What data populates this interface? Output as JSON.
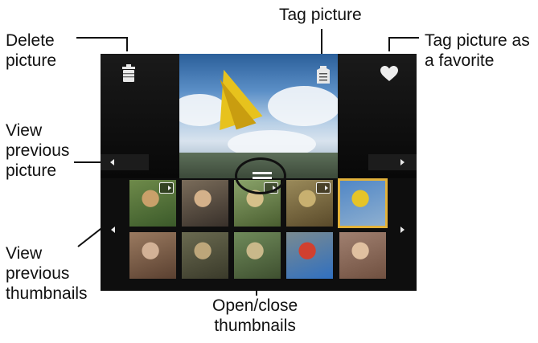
{
  "callouts": {
    "delete": "Delete\npicture",
    "tag": "Tag picture",
    "favorite": "Tag picture as\na favorite",
    "view_previous_picture": "View\nprevious\npicture",
    "view_previous_thumbnails": "View\nprevious\nthumbnails",
    "open_close_thumbnails": "Open/close\nthumbnails"
  },
  "colors": {
    "screen_bg": "#0b0b0b",
    "selection": "#e2b23b",
    "kite": "#e7c21d",
    "sky": "#5b8fc7"
  },
  "icons": {
    "delete": "trash-icon",
    "tag": "tag-icon",
    "favorite": "heart-icon",
    "prev_picture": "left-arrow-icon",
    "next_picture": "right-arrow-icon",
    "prev_thumbs": "left-arrow-icon",
    "next_thumbs": "right-arrow-icon",
    "video_badge": "video-camera-icon",
    "thumbs_handle": "handle-icon"
  },
  "thumbnails": [
    {
      "row": 1,
      "has_video_badge": true,
      "selected": false,
      "colors": [
        "#6e8a4a",
        "#c9a06a",
        "#3b5a2a"
      ]
    },
    {
      "row": 1,
      "has_video_badge": false,
      "selected": false,
      "colors": [
        "#7a6c5a",
        "#d4b18a",
        "#38302a"
      ]
    },
    {
      "row": 1,
      "has_video_badge": true,
      "selected": false,
      "colors": [
        "#8aa36a",
        "#d6c08a",
        "#4a5e30"
      ]
    },
    {
      "row": 1,
      "has_video_badge": true,
      "selected": false,
      "colors": [
        "#9a8a5a",
        "#c8b070",
        "#5a4a2a"
      ]
    },
    {
      "row": 1,
      "has_video_badge": false,
      "selected": true,
      "colors": [
        "#4f86c6",
        "#e6c429",
        "#8fb0d0"
      ]
    },
    {
      "row": 2,
      "has_video_badge": false,
      "selected": false,
      "colors": [
        "#9a7a60",
        "#d2b196",
        "#5a4030"
      ]
    },
    {
      "row": 2,
      "has_video_badge": false,
      "selected": false,
      "colors": [
        "#6a6a50",
        "#bda67a",
        "#3a3a2a"
      ]
    },
    {
      "row": 2,
      "has_video_badge": false,
      "selected": false,
      "colors": [
        "#6f8a5a",
        "#c9b88a",
        "#3f5030"
      ]
    },
    {
      "row": 2,
      "has_video_badge": false,
      "selected": false,
      "colors": [
        "#7a8a90",
        "#d04030",
        "#3070c0"
      ]
    },
    {
      "row": 2,
      "has_video_badge": false,
      "selected": false,
      "colors": [
        "#a08070",
        "#e0c0a0",
        "#705040"
      ]
    }
  ]
}
